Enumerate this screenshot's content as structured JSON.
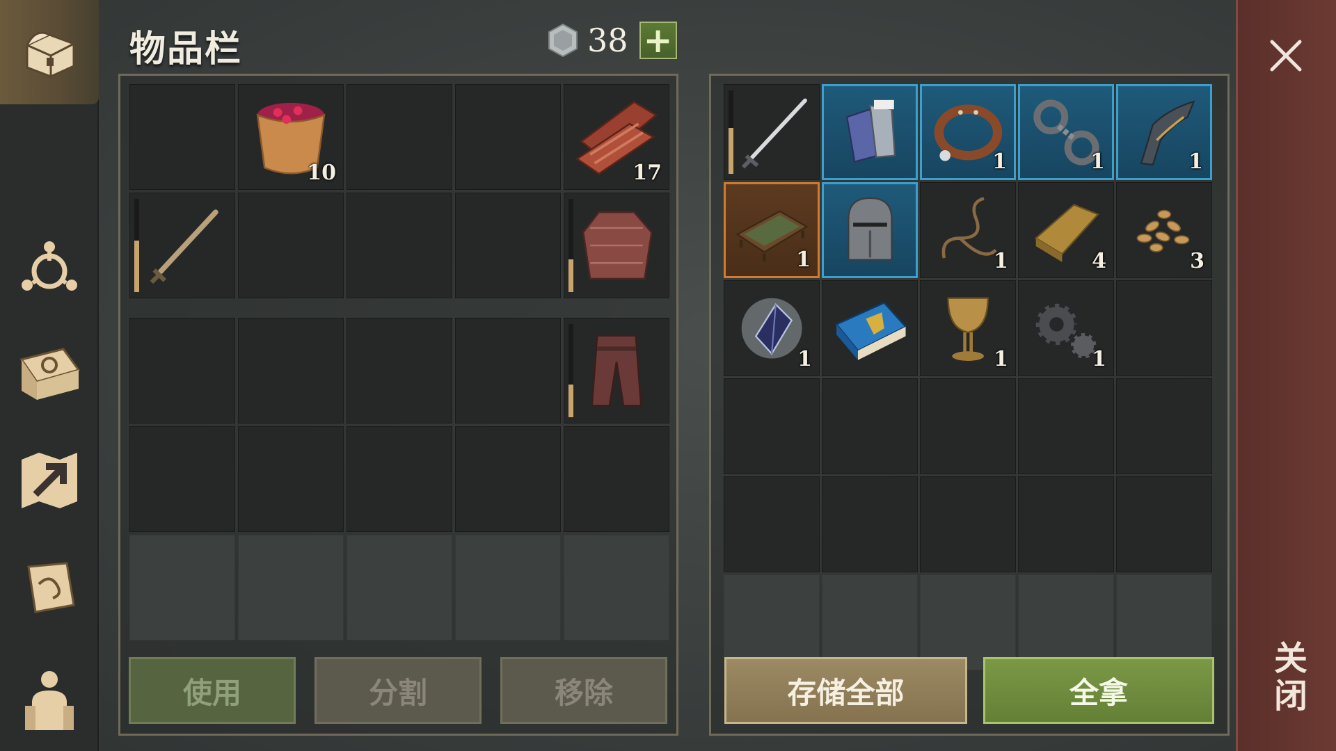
{
  "title": "物品栏",
  "currency": {
    "icon": "silver-coin-icon",
    "amount": "38",
    "add_icon": "plus-icon"
  },
  "sidebar": {
    "tabs": [
      {
        "icon": "chest-icon",
        "active": true
      },
      {
        "icon": "clan-icon",
        "active": false
      },
      {
        "icon": "recipe-book-icon",
        "active": false
      },
      {
        "icon": "map-icon",
        "active": false
      },
      {
        "icon": "quest-scroll-icon",
        "active": false
      },
      {
        "icon": "character-icon",
        "active": false
      }
    ]
  },
  "inventory": {
    "row1": [
      {
        "icon": "",
        "qty": ""
      },
      {
        "icon": "berry-bucket-icon",
        "qty": "10"
      },
      {
        "icon": "",
        "qty": ""
      },
      {
        "icon": "",
        "qty": ""
      },
      {
        "icon": "raw-meat-icon",
        "qty": "17"
      }
    ],
    "row2": [
      {
        "icon": "sword-icon",
        "qty": "",
        "durability": 0.55
      },
      {
        "icon": "",
        "qty": ""
      },
      {
        "icon": "",
        "qty": ""
      },
      {
        "icon": "",
        "qty": ""
      },
      {
        "icon": "chainmail-shirt-icon",
        "qty": "",
        "durability": 0.35
      }
    ],
    "row3": [
      {
        "icon": "",
        "qty": ""
      },
      {
        "icon": "",
        "qty": ""
      },
      {
        "icon": "",
        "qty": ""
      },
      {
        "icon": "",
        "qty": ""
      },
      {
        "icon": "chainmail-pants-icon",
        "qty": "",
        "durability": 0.35
      }
    ]
  },
  "storage": {
    "items": [
      {
        "icon": "longsword-icon",
        "qty": "",
        "rarity": "none",
        "durability": 0.55
      },
      {
        "icon": "gauntlets-icon",
        "qty": "",
        "rarity": "blue"
      },
      {
        "icon": "leather-collar-icon",
        "qty": "1",
        "rarity": "blue"
      },
      {
        "icon": "shackles-icon",
        "qty": "1",
        "rarity": "blue"
      },
      {
        "icon": "ornate-handle-icon",
        "qty": "1",
        "rarity": "blue"
      },
      {
        "icon": "tray-icon",
        "qty": "1",
        "rarity": "orange"
      },
      {
        "icon": "great-helm-icon",
        "qty": "",
        "rarity": "blue"
      },
      {
        "icon": "rope-icon",
        "qty": "1",
        "rarity": "none"
      },
      {
        "icon": "gold-ingot-icon",
        "qty": "4",
        "rarity": "none"
      },
      {
        "icon": "seeds-icon",
        "qty": "3",
        "rarity": "none"
      },
      {
        "icon": "crystal-icon",
        "qty": "1",
        "rarity": "none"
      },
      {
        "icon": "heraldry-book-icon",
        "qty": "",
        "rarity": "none"
      },
      {
        "icon": "goblet-icon",
        "qty": "1",
        "rarity": "none"
      },
      {
        "icon": "gears-icon",
        "qty": "1",
        "rarity": "none"
      }
    ]
  },
  "buttons": {
    "use": "使用",
    "split": "分割",
    "remove": "移除",
    "store_all": "存储全部",
    "take_all": "全拿"
  },
  "close": {
    "label": "关闭",
    "icon": "close-icon"
  }
}
